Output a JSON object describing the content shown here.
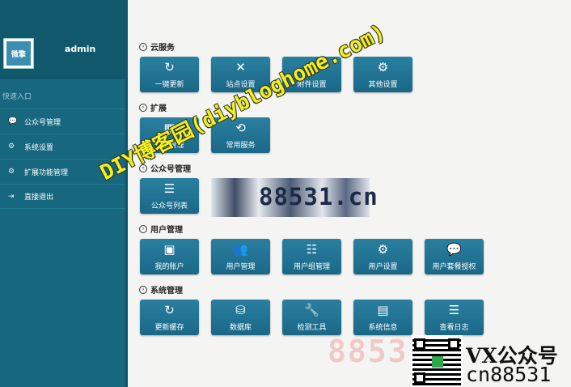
{
  "sidebar": {
    "username": "admin",
    "logo_text": "微擎",
    "quick_entry": "快速入口",
    "items": [
      {
        "icon": "💬",
        "label": "公众号管理"
      },
      {
        "icon": "⚙",
        "label": "系统设置"
      },
      {
        "icon": "⚙",
        "label": "扩展功能管理"
      },
      {
        "icon": "⇥",
        "label": "直接退出"
      }
    ]
  },
  "sections": [
    {
      "title": "云服务",
      "tiles": [
        {
          "icon": "↻",
          "label": "一键更新"
        },
        {
          "icon": "✕",
          "label": "站点设置"
        },
        {
          "icon": "✕",
          "label": "附件设置"
        },
        {
          "icon": "⚙",
          "label": "其他设置"
        }
      ]
    },
    {
      "title": "扩展",
      "tiles": [
        {
          "icon": "▦",
          "label": "模块管理"
        },
        {
          "icon": "⟲",
          "label": "常用服务"
        }
      ]
    },
    {
      "title": "公众号管理",
      "tiles": [
        {
          "icon": "☰",
          "label": "公众号列表"
        }
      ]
    },
    {
      "title": "用户管理",
      "tiles": [
        {
          "icon": "▣",
          "label": "我的账户"
        },
        {
          "icon": "👥",
          "label": "用户管理"
        },
        {
          "icon": "☷",
          "label": "用户组管理"
        },
        {
          "icon": "⚙",
          "label": "用户设置"
        },
        {
          "icon": "💬",
          "label": "用户套餐授权"
        }
      ]
    },
    {
      "title": "系统管理",
      "tiles": [
        {
          "icon": "↻",
          "label": "更新缓存"
        },
        {
          "icon": "⛁",
          "label": "数据库"
        },
        {
          "icon": "🔧",
          "label": "检测工具"
        },
        {
          "icon": "▤",
          "label": "系统信息"
        },
        {
          "icon": "☰",
          "label": "查看日志"
        }
      ]
    }
  ],
  "overlays": {
    "blurred_text": "88531.cn",
    "diagonal_watermark": "DIY博客园(diybloghome.com)",
    "faint_watermark": "88531",
    "vx_label": "VX公众号",
    "vx_id": "cn88531"
  }
}
